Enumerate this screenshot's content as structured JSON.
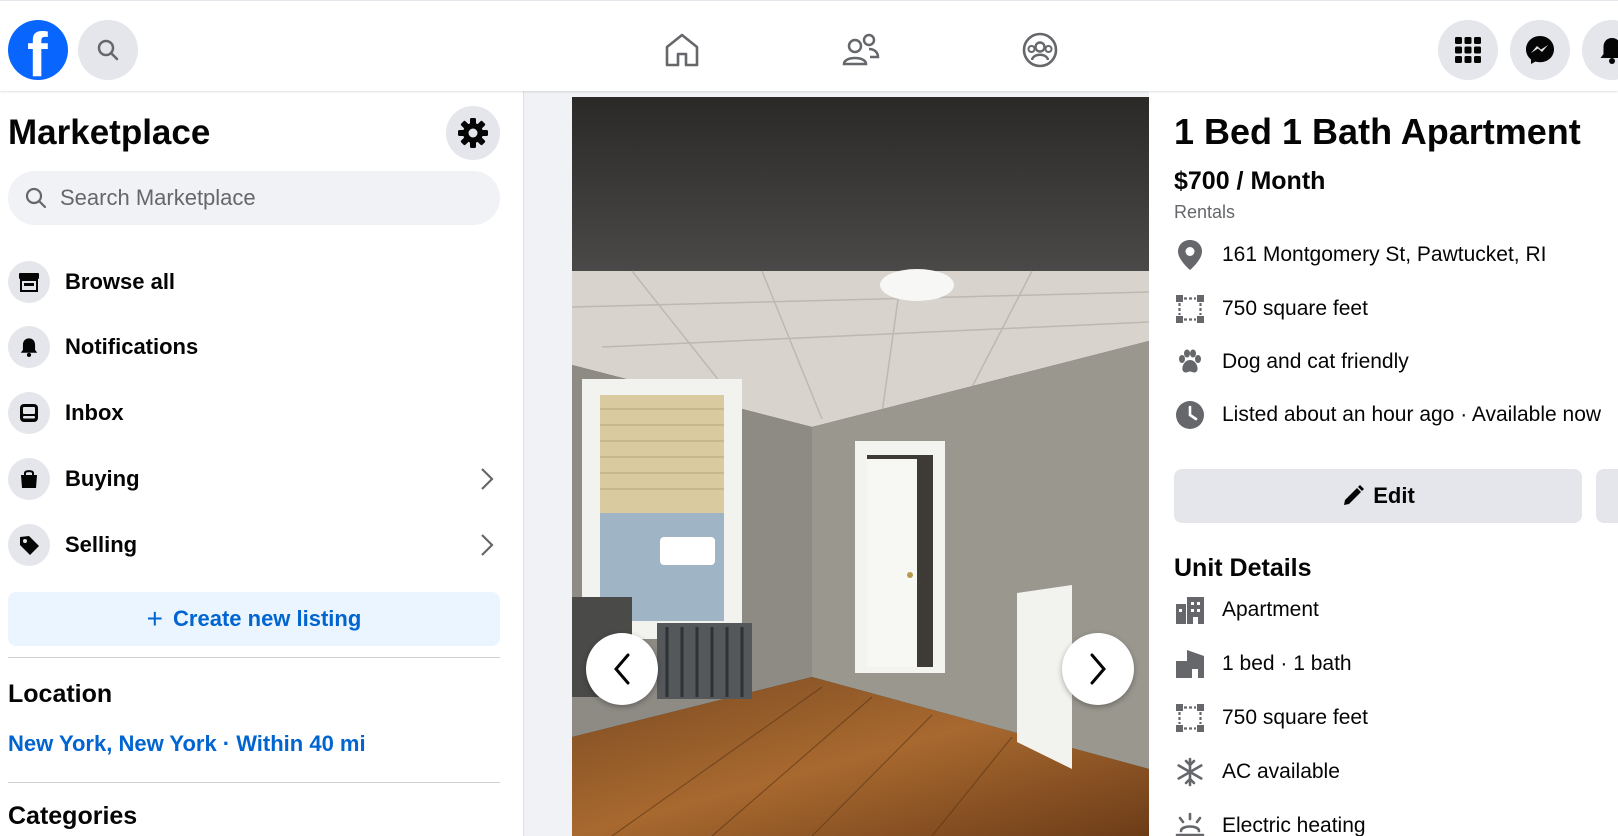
{
  "colors": {
    "brand": "#0866ff",
    "link": "#0064d1",
    "icon_gray": "#65676b"
  },
  "nav": {
    "logo_letter": "f",
    "icons": [
      "search-icon",
      "home-icon",
      "friends-icon",
      "groups-icon",
      "menu-grid-icon",
      "messenger-icon",
      "bell-icon"
    ]
  },
  "sidebar": {
    "title": "Marketplace",
    "search_placeholder": "Search Marketplace",
    "items": [
      {
        "label": "Browse all",
        "icon": "storefront-icon"
      },
      {
        "label": "Notifications",
        "icon": "bell-icon"
      },
      {
        "label": "Inbox",
        "icon": "inbox-icon"
      },
      {
        "label": "Buying",
        "icon": "shopping-bag-icon"
      },
      {
        "label": "Selling",
        "icon": "price-tag-icon"
      }
    ],
    "create_label": "Create new listing",
    "location_heading": "Location",
    "location_value": "New York, New York · Within 40 mi",
    "categories_heading": "Categories"
  },
  "listing": {
    "title": "1 Bed 1 Bath Apartment",
    "price": "$700 / Month",
    "category": "Rentals",
    "address": "161 Montgomery St, Pawtucket, RI",
    "size": "750 square feet",
    "pets": "Dog and cat friendly",
    "listed": "Listed about an hour ago · Available now",
    "edit_label": "Edit",
    "unit_heading": "Unit Details",
    "unit": {
      "type": "Apartment",
      "rooms": "1 bed · 1 bath",
      "size": "750 square feet",
      "ac": "AC available",
      "heating": "Electric heating"
    }
  }
}
